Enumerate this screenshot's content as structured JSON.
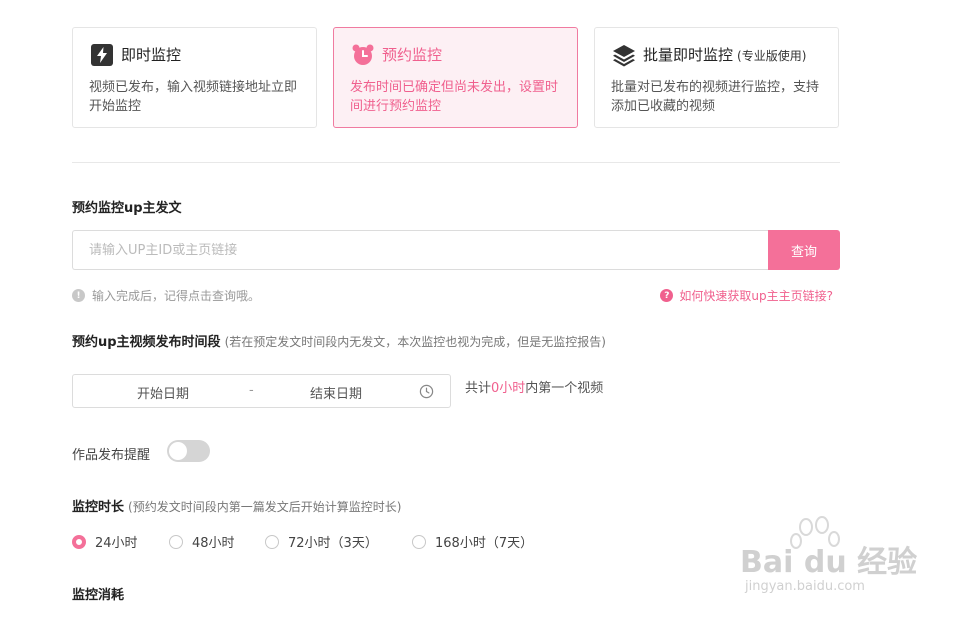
{
  "cards": [
    {
      "title": "即时监控",
      "desc": "视频已发布，输入视频链接地址立即开始监控",
      "icon": "lightning-icon"
    },
    {
      "title": "预约监控",
      "desc": "发布时间已确定但尚未发出，设置时间进行预约监控",
      "icon": "alarm-clock-icon"
    },
    {
      "title": "批量即时监控",
      "badge": "(专业版使用)",
      "desc": "批量对已发布的视频进行监控，支持添加已收藏的视频",
      "icon": "layers-icon"
    }
  ],
  "section_up": {
    "label": "预约监控up主发文"
  },
  "search": {
    "placeholder": "请输入UP主ID或主页链接",
    "button": "查询"
  },
  "hint": {
    "text": "输入完成后，记得点击查询哦。",
    "help": "如何快速获取up主主页链接?"
  },
  "period": {
    "label": "预约up主视频发布时间段",
    "note": "(若在预定发文时间段内无发文，本次监控也视为完成，但是无监控报告)",
    "start": "开始日期",
    "sep": "-",
    "end": "结束日期",
    "total_prefix": "共计",
    "total_value": "0小时",
    "total_suffix": "内第一个视频"
  },
  "reminder": {
    "label": "作品发布提醒",
    "enabled": false
  },
  "duration": {
    "label": "监控时长",
    "note": "(预约发文时间段内第一篇发文后开始计算监控时长)",
    "options": [
      "24小时",
      "48小时",
      "72小时（3天）",
      "168小时（7天）"
    ],
    "selected": 0
  },
  "cost": {
    "label": "监控消耗"
  },
  "watermark": {
    "brand": "Bai du 经验",
    "url": "jingyan.baidu.com"
  },
  "colors": {
    "accent": "#f47099"
  }
}
